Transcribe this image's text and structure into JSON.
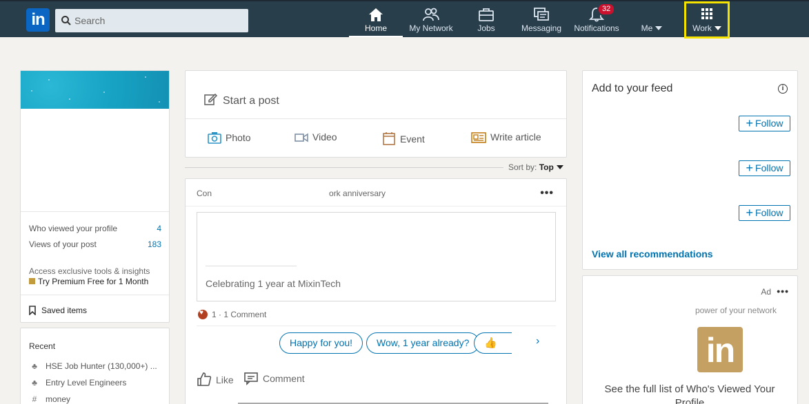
{
  "nav": {
    "logo": "in",
    "search_placeholder": "Search",
    "items": [
      {
        "label": "Home"
      },
      {
        "label": "My Network"
      },
      {
        "label": "Jobs"
      },
      {
        "label": "Messaging"
      },
      {
        "label": "Notifications",
        "badge": "32"
      },
      {
        "label": "Me"
      },
      {
        "label": "Work"
      }
    ]
  },
  "profile": {
    "who_viewed_label": "Who viewed your profile",
    "who_viewed_count": "4",
    "post_views_label": "Views of your post",
    "post_views_count": "183",
    "premium_text": "Access exclusive tools & insights",
    "premium_link": "Try Premium Free for 1 Month",
    "saved_items": "Saved items"
  },
  "recent": {
    "title": "Recent",
    "items": [
      {
        "label": "HSE Job Hunter (130,000+) ...",
        "icon": "group-icon"
      },
      {
        "label": "Entry Level Engineers",
        "icon": "group-icon"
      },
      {
        "label": "money",
        "icon": "hashtag-icon"
      }
    ]
  },
  "share": {
    "start_post": "Start a post",
    "photo": "Photo",
    "video": "Video",
    "event": "Event",
    "write_article": "Write article"
  },
  "sort": {
    "label": "Sort by:",
    "value": "Top"
  },
  "feed": {
    "header_start": "Con",
    "header_end": "ork anniversary",
    "celebrating": "Celebrating 1 year at MixinTech",
    "reactions": "1 · 1 Comment",
    "chips": [
      "Happy for you!",
      "Wow, 1 year already?"
    ],
    "like": "Like",
    "comment": "Comment"
  },
  "recommendations": {
    "title": "Add to your feed",
    "follow_label": "Follow",
    "view_all": "View all recommendations"
  },
  "ad": {
    "label": "Ad",
    "subtitle": "power of your network",
    "logo": "in",
    "text": "See the full list of Who's Viewed Your Profile"
  },
  "colors": {
    "navbar": "#283e4a",
    "link": "#0073b1",
    "highlight": "#f6e300",
    "badge": "#cb112d",
    "premium_gold": "#c4a062"
  }
}
